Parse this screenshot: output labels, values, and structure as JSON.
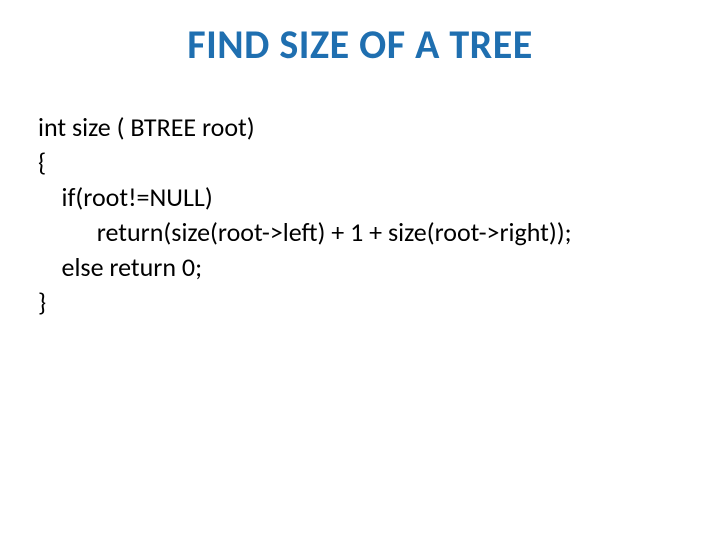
{
  "title": "FIND SIZE OF A TREE",
  "code": {
    "l1": "int size ( BTREE root)",
    "l2": "{",
    "l3": "    if(root!=NULL)",
    "l4": "          return(size(root->left) + 1 + size(root->right));",
    "l5": "    else return 0;",
    "l6": "}"
  }
}
